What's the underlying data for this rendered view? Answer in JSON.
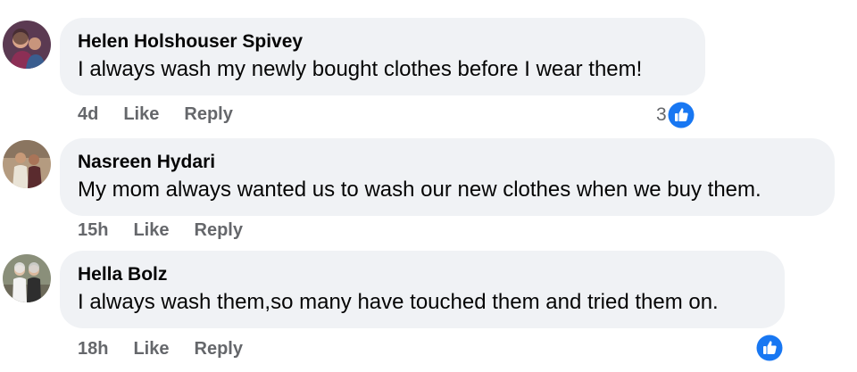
{
  "comments": [
    {
      "author": "Helen Holshouser Spivey",
      "text": "I always wash my newly bought clothes before I wear them!",
      "time": "4d",
      "like_label": "Like",
      "reply_label": "Reply",
      "reaction_count": "3",
      "reaction_icon": "like-icon"
    },
    {
      "author": "Nasreen Hydari",
      "text": "My mom always wanted us to wash our new clothes when we buy them.",
      "time": "15h",
      "like_label": "Like",
      "reply_label": "Reply"
    },
    {
      "author": "Hella Bolz",
      "text": "I always wash them,so many have touched them and tried them on.",
      "time": "18h",
      "like_label": "Like",
      "reply_label": "Reply",
      "reaction_icon": "like-icon"
    }
  ],
  "colors": {
    "bubble_bg": "#f0f2f5",
    "text": "#050505",
    "secondary_text": "#65676b",
    "like_blue": "#1877f2"
  }
}
